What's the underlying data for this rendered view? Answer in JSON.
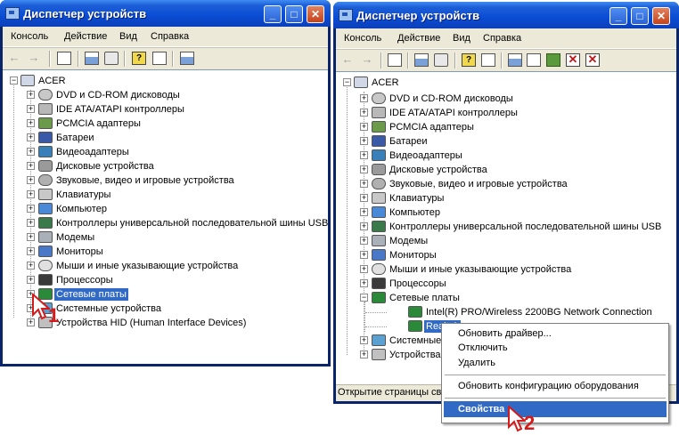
{
  "windows": [
    {
      "title": "Диспетчер устройств",
      "menu": [
        "Консоль",
        "Действие",
        "Вид",
        "Справка"
      ],
      "root": "ACER",
      "tree": [
        {
          "label": "DVD и CD-ROM дисководы",
          "icon": "disc-icon"
        },
        {
          "label": "IDE ATA/ATAPI контроллеры",
          "icon": "ide-controller-icon"
        },
        {
          "label": "PCMCIA адаптеры",
          "icon": "pcmcia-icon"
        },
        {
          "label": "Батареи",
          "icon": "battery-icon"
        },
        {
          "label": "Видеоадаптеры",
          "icon": "video-adapter-icon"
        },
        {
          "label": "Дисковые устройства",
          "icon": "disk-drive-icon"
        },
        {
          "label": "Звуковые, видео и игровые устройства",
          "icon": "sound-icon"
        },
        {
          "label": "Клавиатуры",
          "icon": "keyboard-icon"
        },
        {
          "label": "Компьютер",
          "icon": "computer-icon"
        },
        {
          "label": "Контроллеры универсальной последовательной шины USB",
          "icon": "usb-icon"
        },
        {
          "label": "Модемы",
          "icon": "modem-icon"
        },
        {
          "label": "Мониторы",
          "icon": "monitor-icon"
        },
        {
          "label": "Мыши и иные указывающие устройства",
          "icon": "mouse-icon"
        },
        {
          "label": "Процессоры",
          "icon": "cpu-icon"
        },
        {
          "label": "Сетевые платы",
          "icon": "network-card-icon",
          "selected": true
        },
        {
          "label": "Системные устройства",
          "icon": "system-device-icon"
        },
        {
          "label": "Устройства HID (Human Interface Devices)",
          "icon": "hid-icon"
        }
      ]
    },
    {
      "title": "Диспетчер устройств",
      "menu": [
        "Консоль",
        "Действие",
        "Вид",
        "Справка"
      ],
      "root": "ACER",
      "tree": [
        {
          "label": "DVD и CD-ROM дисководы",
          "icon": "disc-icon"
        },
        {
          "label": "IDE ATA/ATAPI контроллеры",
          "icon": "ide-controller-icon"
        },
        {
          "label": "PCMCIA адаптеры",
          "icon": "pcmcia-icon"
        },
        {
          "label": "Батареи",
          "icon": "battery-icon"
        },
        {
          "label": "Видеоадаптеры",
          "icon": "video-adapter-icon"
        },
        {
          "label": "Дисковые устройства",
          "icon": "disk-drive-icon"
        },
        {
          "label": "Звуковые, видео и игровые устройства",
          "icon": "sound-icon"
        },
        {
          "label": "Клавиатуры",
          "icon": "keyboard-icon"
        },
        {
          "label": "Компьютер",
          "icon": "computer-icon"
        },
        {
          "label": "Контроллеры универсальной последовательной шины USB",
          "icon": "usb-icon"
        },
        {
          "label": "Модемы",
          "icon": "modem-icon"
        },
        {
          "label": "Мониторы",
          "icon": "monitor-icon"
        },
        {
          "label": "Мыши и иные указывающие устройства",
          "icon": "mouse-icon"
        },
        {
          "label": "Процессоры",
          "icon": "cpu-icon"
        },
        {
          "label": "Сетевые платы",
          "icon": "network-card-icon",
          "expanded": true
        },
        {
          "label": "Intel(R) PRO/Wireless 2200BG Network Connection",
          "icon": "network-card-icon",
          "child": true
        },
        {
          "label": "Realtek",
          "icon": "network-card-icon",
          "child": true,
          "selected": true
        },
        {
          "label": "Системные",
          "icon": "system-device-icon"
        },
        {
          "label": "Устройства",
          "icon": "hid-icon"
        }
      ],
      "status": "Открытие страницы св"
    }
  ],
  "context_menu": {
    "items": [
      {
        "label": "Обновить драйвер..."
      },
      {
        "label": "Отключить"
      },
      {
        "label": "Удалить"
      },
      {
        "label": "Обновить конфигурацию оборудования"
      },
      {
        "label": "Свойства",
        "highlighted": true
      }
    ]
  },
  "callouts": [
    "1",
    "2"
  ],
  "colors": {
    "title_bar": "#0a4cd4",
    "selection": "#316ac5",
    "callout": "#d41a1a",
    "window_bg": "#ece9d8"
  }
}
